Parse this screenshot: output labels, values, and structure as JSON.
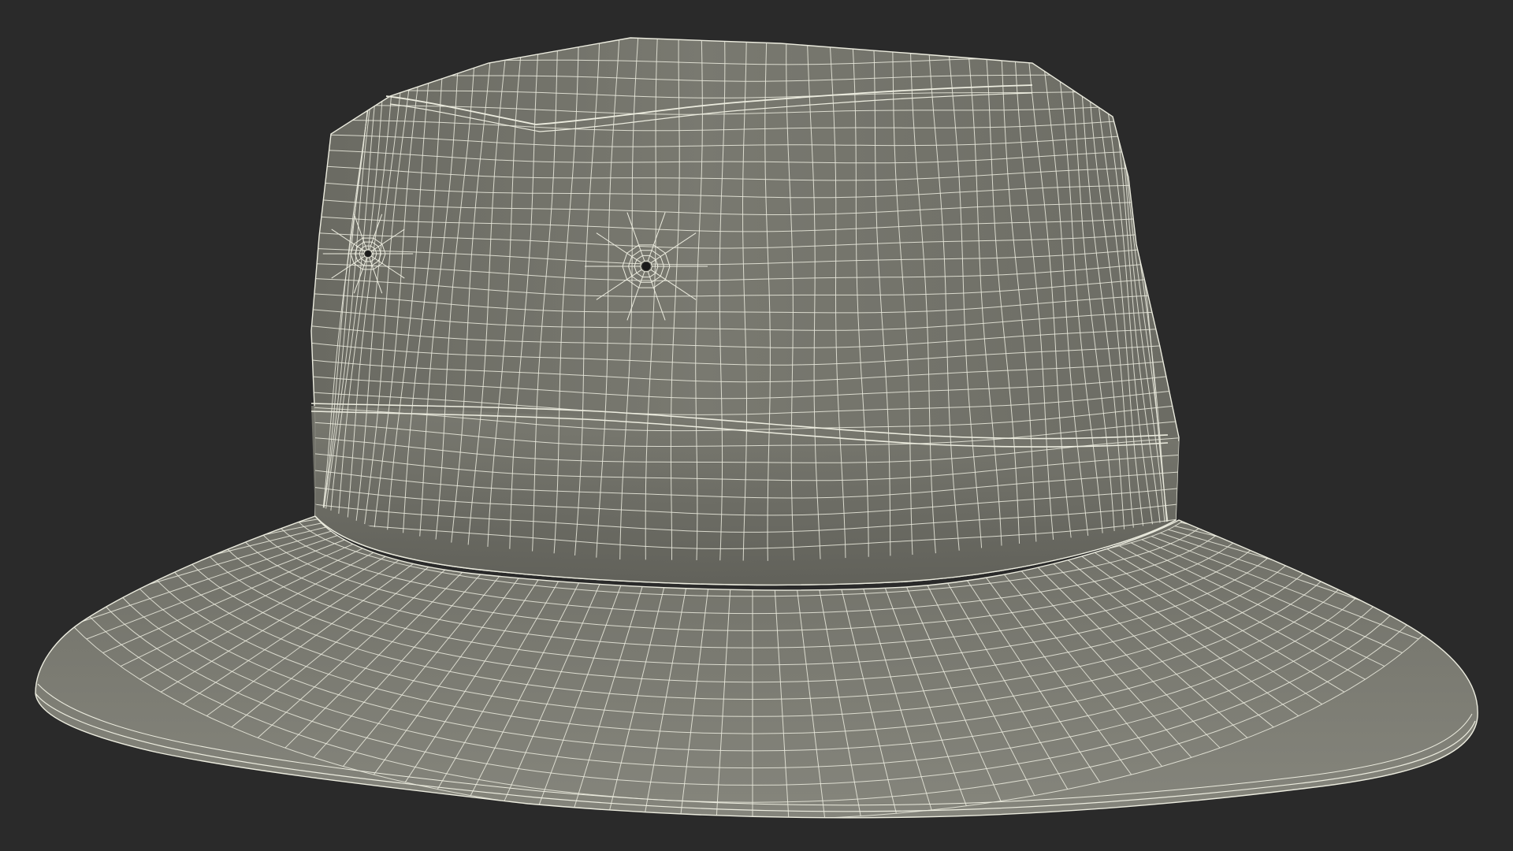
{
  "scene": {
    "subject": "bucket-hat",
    "render_mode": "wireframe-over-shaded",
    "colors": {
      "background": "#2a2a2a",
      "surface": "#74746b",
      "surface_shadow": "#5c5c55",
      "surface_highlight": "#888880",
      "wire": "#ececdf",
      "eyelet": "#1a1a1a"
    },
    "eyelet_count": 2
  }
}
